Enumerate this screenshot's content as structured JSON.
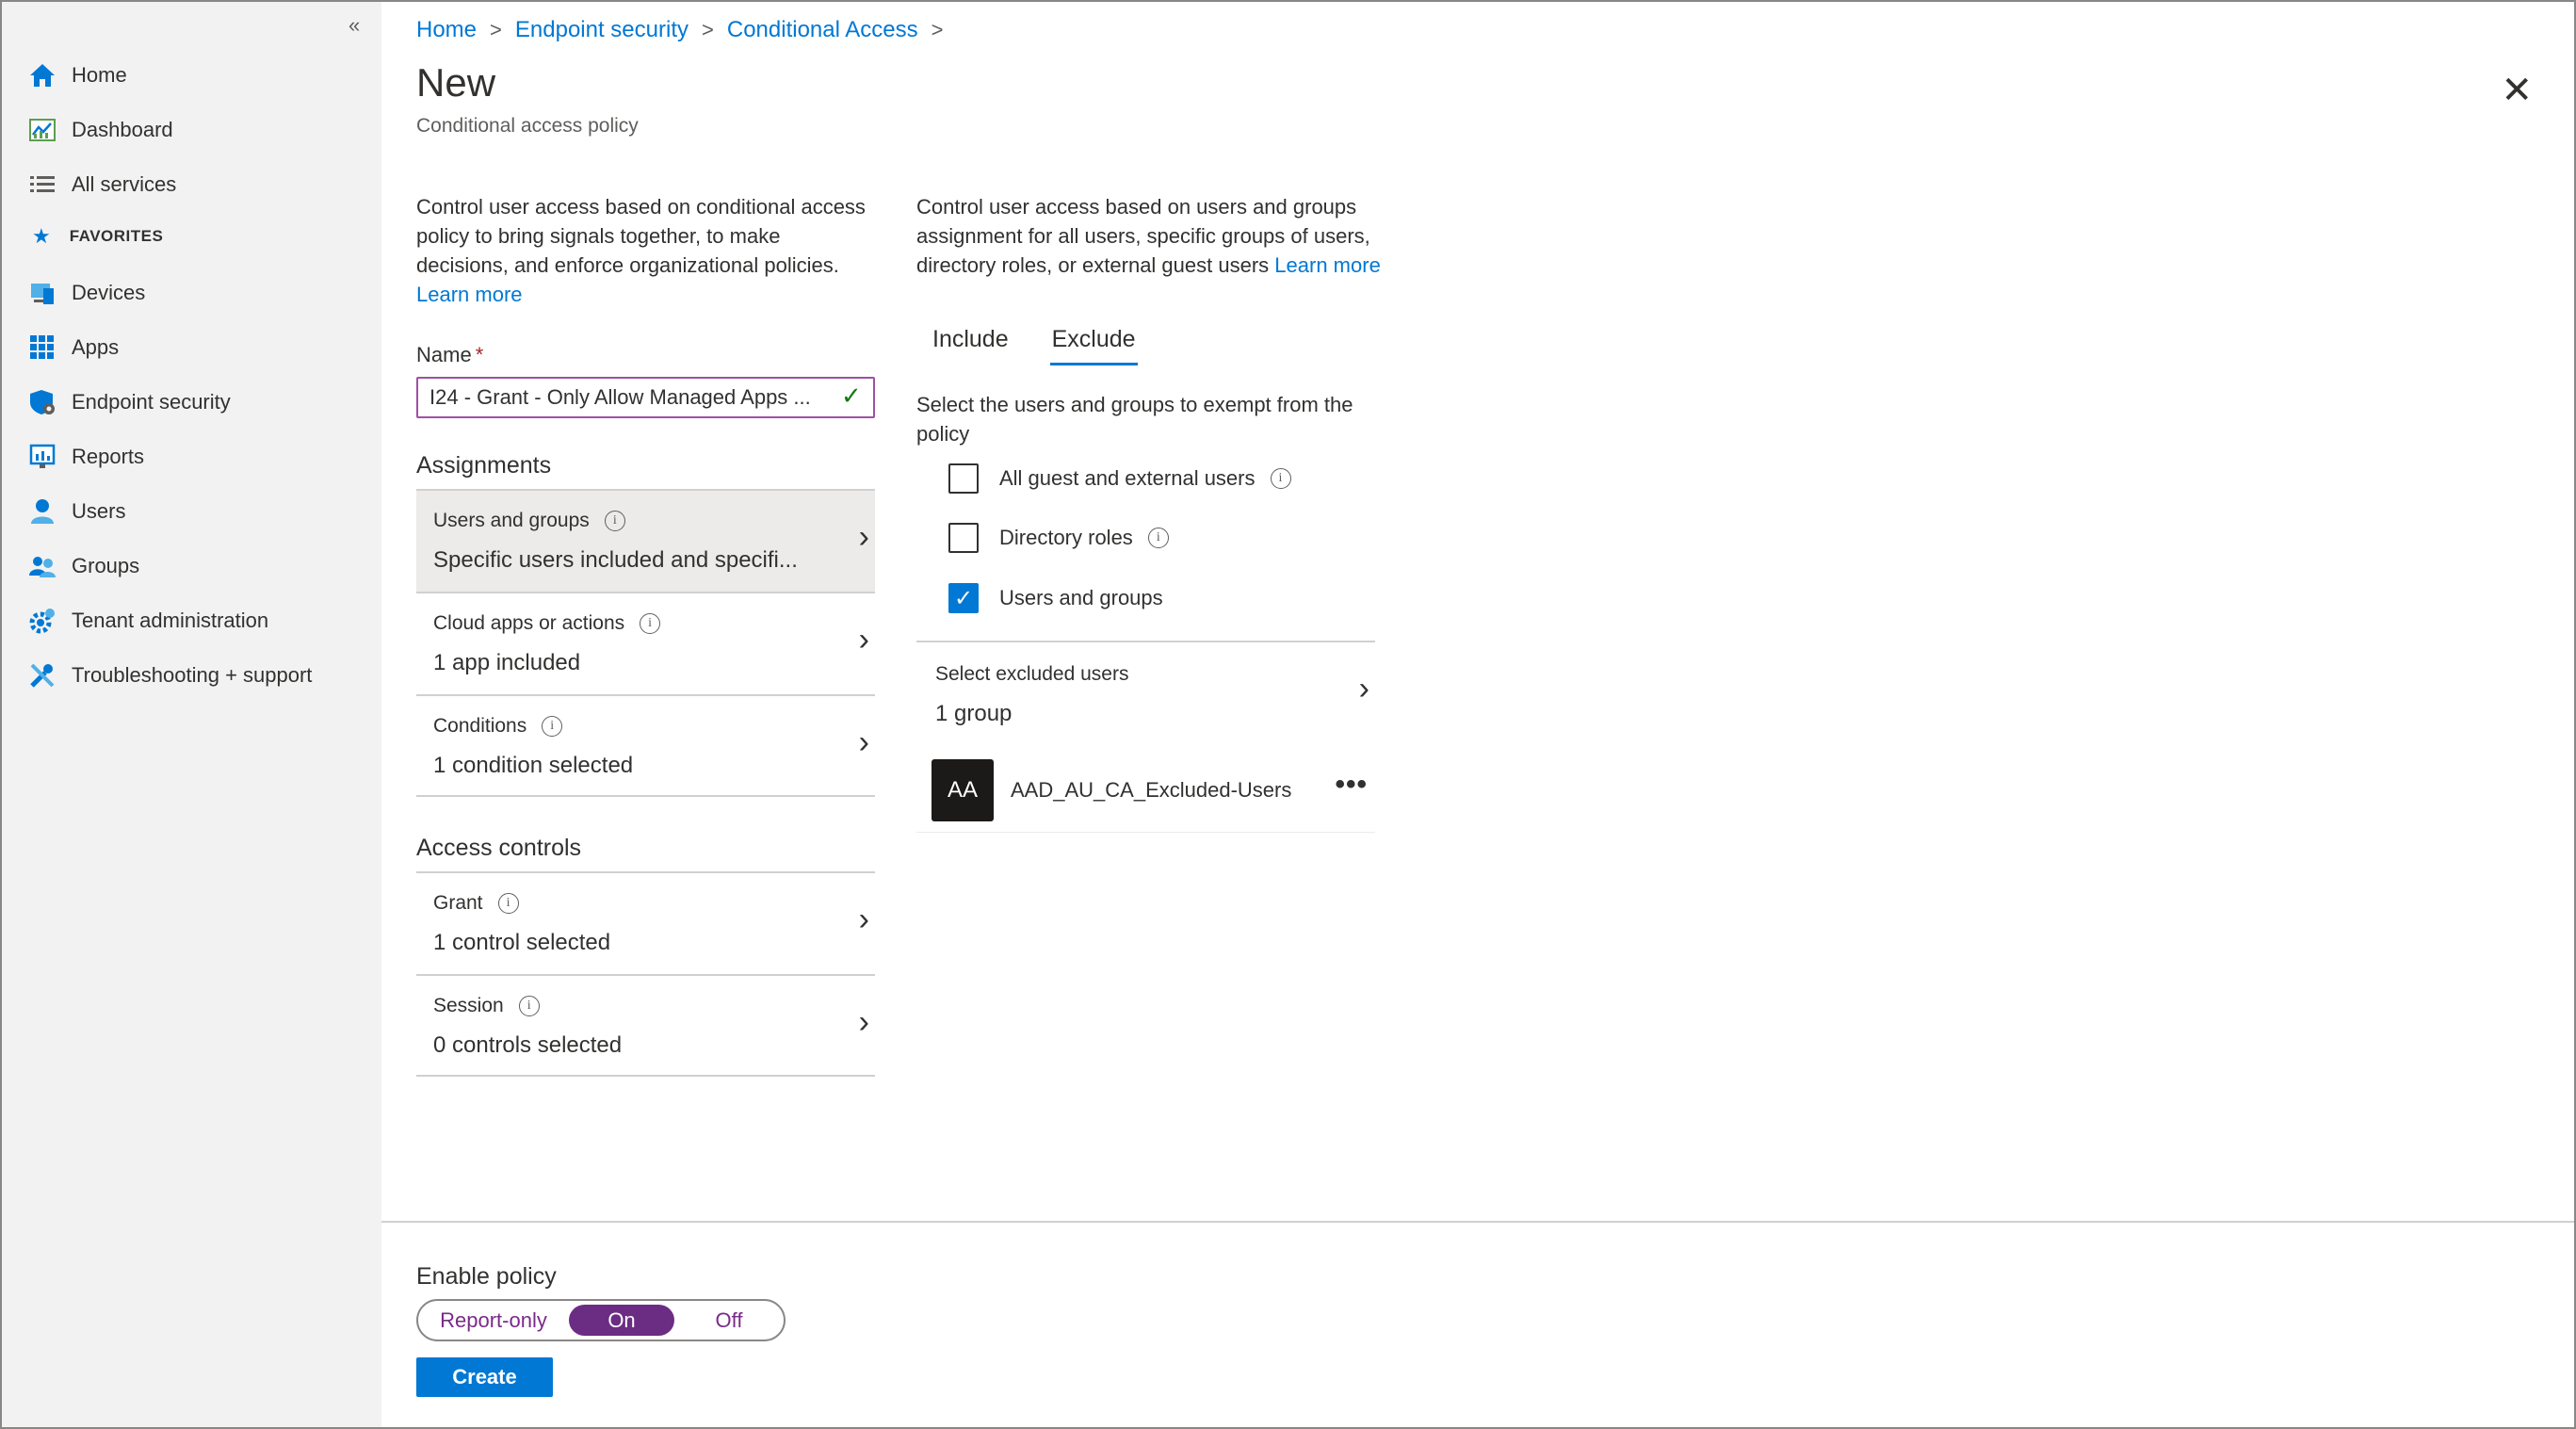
{
  "sidebar": {
    "collapse": "«",
    "items": [
      {
        "label": "Home",
        "icon": "home-icon"
      },
      {
        "label": "Dashboard",
        "icon": "dashboard-icon"
      },
      {
        "label": "All services",
        "icon": "list-icon"
      },
      {
        "label": "Devices",
        "icon": "devices-icon"
      },
      {
        "label": "Apps",
        "icon": "apps-grid-icon"
      },
      {
        "label": "Endpoint security",
        "icon": "shield-icon"
      },
      {
        "label": "Reports",
        "icon": "reports-icon"
      },
      {
        "label": "Users",
        "icon": "user-icon"
      },
      {
        "label": "Groups",
        "icon": "groups-icon"
      },
      {
        "label": "Tenant administration",
        "icon": "gear-icon"
      },
      {
        "label": "Troubleshooting + support",
        "icon": "wrench-icon"
      }
    ],
    "favorites_label": "FAVORITES"
  },
  "breadcrumb": [
    "Home",
    "Endpoint security",
    "Conditional Access"
  ],
  "page": {
    "title": "New",
    "subtitle": "Conditional access policy"
  },
  "left_desc": {
    "text": "Control user access based on conditional access policy to bring signals together, to make decisions, and enforce organizational policies.",
    "link": "Learn more"
  },
  "name_field": {
    "label": "Name",
    "required": "*",
    "value": "I24 - Grant - Only Allow Managed Apps ..."
  },
  "assignments": {
    "title": "Assignments",
    "rows": [
      {
        "title": "Users and groups",
        "value": "Specific users included and specifi..."
      },
      {
        "title": "Cloud apps or actions",
        "value": "1 app included"
      },
      {
        "title": "Conditions",
        "value": "1 condition selected"
      }
    ]
  },
  "access_controls": {
    "title": "Access controls",
    "rows": [
      {
        "title": "Grant",
        "value": "1 control selected"
      },
      {
        "title": "Session",
        "value": "0 controls selected"
      }
    ]
  },
  "right_desc": {
    "text": "Control user access based on users and groups assignment for all users, specific groups of users, directory roles, or external guest users",
    "link": "Learn more"
  },
  "tabs": {
    "include": "Include",
    "exclude": "Exclude",
    "active": "Exclude"
  },
  "exclude_instructions": "Select the users and groups to exempt from the policy",
  "checkboxes": [
    {
      "label": "All guest and external users",
      "checked": false
    },
    {
      "label": "Directory roles",
      "checked": false
    },
    {
      "label": "Users and groups",
      "checked": true
    }
  ],
  "excluded_users": {
    "title": "Select excluded users",
    "value": "1 group"
  },
  "group": {
    "initials": "AA",
    "name": "AAD_AU_CA_Excluded-Users",
    "more": "•••"
  },
  "enable_policy": {
    "label": "Enable policy",
    "options": [
      "Report-only",
      "On",
      "Off"
    ],
    "selected": "On"
  },
  "create_button": "Create",
  "colors": {
    "accent": "#0078d4",
    "toggle_on": "#6b2d83",
    "valid": "#107c10"
  }
}
